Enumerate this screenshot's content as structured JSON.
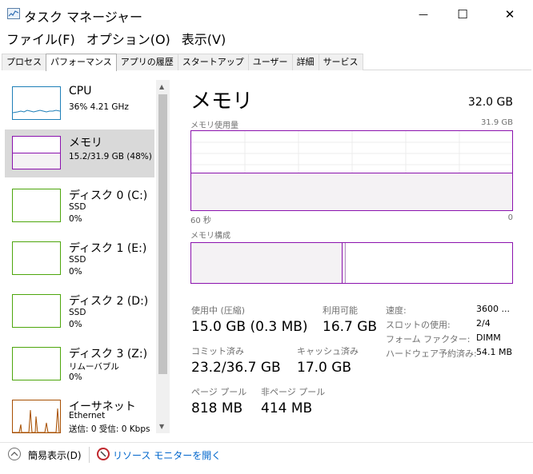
{
  "window": {
    "title": "タスク マネージャー",
    "minimize_glyph": "—",
    "maximize_glyph": "☐",
    "close_glyph": "✕"
  },
  "menu": [
    "ファイル(F)",
    "オプション(O)",
    "表示(V)"
  ],
  "tabs": [
    {
      "label": "プロセス",
      "active": false
    },
    {
      "label": "パフォーマンス",
      "active": true
    },
    {
      "label": "アプリの履歴",
      "active": false
    },
    {
      "label": "スタートアップ",
      "active": false
    },
    {
      "label": "ユーザー",
      "active": false
    },
    {
      "label": "詳細",
      "active": false
    },
    {
      "label": "サービス",
      "active": false
    }
  ],
  "resources": [
    {
      "name": "CPU",
      "line1": "36%  4.21 GHz",
      "line2": "",
      "color": "#1e7fb8"
    },
    {
      "name": "メモリ",
      "line1": "15.2/31.9 GB (48%)",
      "line2": "",
      "color": "#8b12ae"
    },
    {
      "name": "ディスク 0 (C:)",
      "line1": "SSD",
      "line2": "0%",
      "color": "#4da60c"
    },
    {
      "name": "ディスク 1 (E:)",
      "line1": "SSD",
      "line2": "0%",
      "color": "#4da60c"
    },
    {
      "name": "ディスク 2 (D:)",
      "line1": "SSD",
      "line2": "0%",
      "color": "#4da60c"
    },
    {
      "name": "ディスク 3 (Z:)",
      "line1": "リムーバブル",
      "line2": "0%",
      "color": "#4da60c"
    },
    {
      "name": "イーサネット",
      "line1": "Ethernet",
      "line2": "送信: 0 受信: 0 Kbps",
      "color": "#a74f01"
    }
  ],
  "memory": {
    "title": "メモリ",
    "total": "32.0 GB",
    "usage_label": "メモリ使用量",
    "usage_max": "31.9 GB",
    "usage_fraction": 0.48,
    "time_left": "60 秒",
    "time_right": "0",
    "composition_label": "メモリ構成",
    "stats": {
      "in_use_label": "使用中 (圧縮)",
      "in_use_value": "15.0 GB (0.3 MB)",
      "available_label": "利用可能",
      "available_value": "16.7 GB",
      "committed_label": "コミット済み",
      "committed_value": "23.2/36.7 GB",
      "cached_label": "キャッシュ済み",
      "cached_value": "17.0 GB",
      "paged_label": "ページ プール",
      "paged_value": "818 MB",
      "nonpaged_label": "非ページ プール",
      "nonpaged_value": "414 MB"
    },
    "details": [
      {
        "label": "速度:",
        "value": "3600 ..."
      },
      {
        "label": "スロットの使用:",
        "value": "2/4"
      },
      {
        "label": "フォーム ファクター:",
        "value": "DIMM"
      },
      {
        "label": "ハードウェア予約済み:",
        "value": "54.1 MB"
      }
    ]
  },
  "footer": {
    "fewer_details": "簡易表示(D)",
    "resource_monitor": "リソース モニターを開く"
  }
}
